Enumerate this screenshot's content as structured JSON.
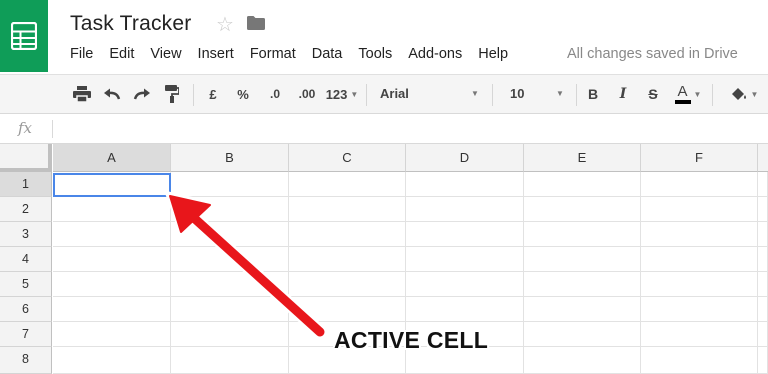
{
  "header": {
    "title": "Task Tracker",
    "save_status": "All changes saved in Drive"
  },
  "menu": [
    "File",
    "Edit",
    "View",
    "Insert",
    "Format",
    "Data",
    "Tools",
    "Add-ons",
    "Help"
  ],
  "toolbar": {
    "currency": "£",
    "percent": "%",
    "decrease_decimal": ".0",
    "increase_decimal": ".00",
    "number_format": "123",
    "font": "Arial",
    "font_size": "10",
    "bold": "B",
    "italic": "I",
    "strikethrough": "S",
    "text_color_glyph": "A"
  },
  "formula_bar": {
    "fx": "fx",
    "value": ""
  },
  "sheet": {
    "columns": [
      "A",
      "B",
      "C",
      "D",
      "E",
      "F"
    ],
    "rows": [
      "1",
      "2",
      "3",
      "4",
      "5",
      "6",
      "7",
      "8"
    ],
    "active_cell": "A1"
  },
  "annotation": {
    "label": "ACTIVE CELL",
    "color": "#e8161b"
  }
}
